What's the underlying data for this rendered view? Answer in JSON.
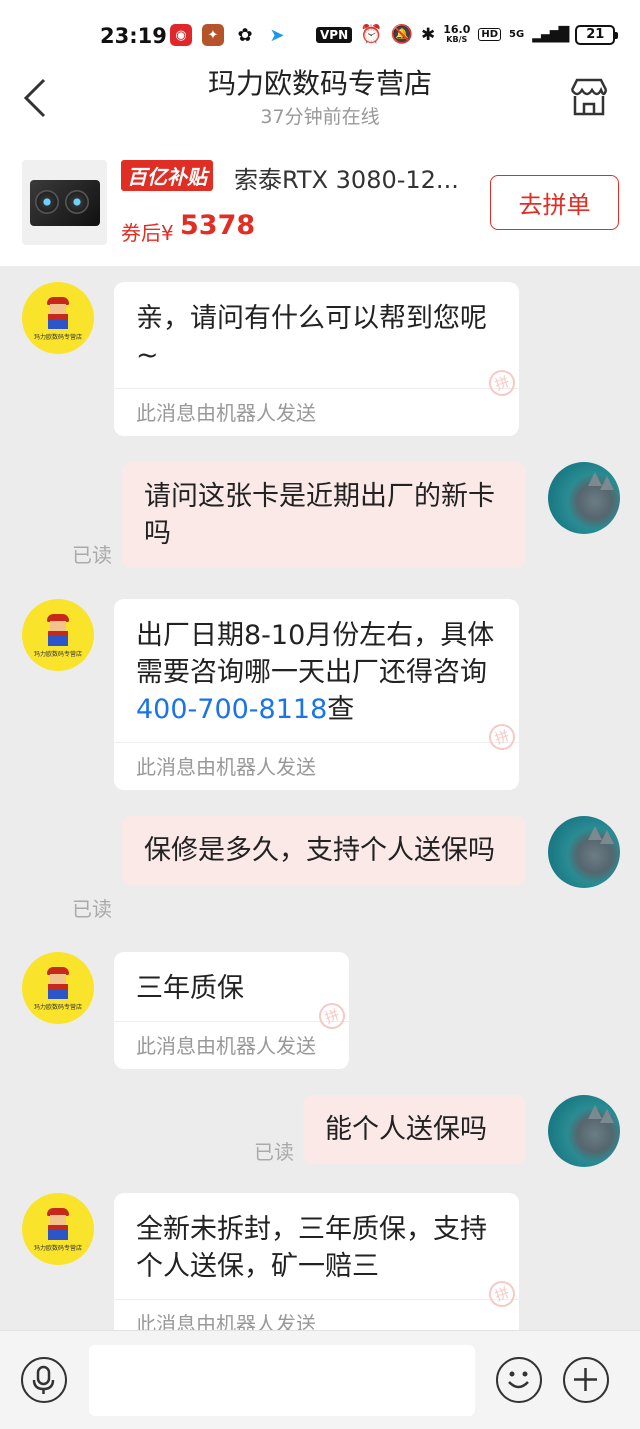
{
  "status_bar": {
    "time": "23:19",
    "vpn": "VPN",
    "speed_value": "16.0",
    "speed_unit": "KB/S",
    "hd": "HD",
    "network": "5G",
    "battery": "21"
  },
  "header": {
    "shop_name": "玛力欧数码专营店",
    "online_status": "37分钟前在线"
  },
  "product": {
    "badge": "百亿补贴",
    "name": "索泰RTX 3080-12...",
    "price_label": "券后¥",
    "price": "5378",
    "join_button": "去拼单"
  },
  "shop_avatar_text": "玛力欧数码专营店",
  "messages": [
    {
      "from": "shop",
      "text": "亲，请问有什么可以帮到您呢~",
      "footer": "此消息由机器人发送"
    },
    {
      "from": "me",
      "text": "请问这张卡是近期出厂的新卡吗",
      "read": "已读"
    },
    {
      "from": "shop",
      "text_before": "出厂日期8-10月份左右，具体需要咨询哪一天出厂还得咨询",
      "phone": "400-700-8118",
      "text_after": "查",
      "footer": "此消息由机器人发送"
    },
    {
      "from": "me",
      "text": "保修是多久，支持个人送保吗",
      "read": "已读"
    },
    {
      "from": "shop",
      "text": "三年质保",
      "footer": "此消息由机器人发送"
    },
    {
      "from": "me",
      "text": "能个人送保吗",
      "read": "已读"
    },
    {
      "from": "shop",
      "text": "全新未拆封，三年质保，支持个人送保，矿一赔三",
      "footer": "此消息由机器人发送"
    }
  ],
  "input_bar": {
    "placeholder": ""
  },
  "colors": {
    "accent_red": "#e02e24",
    "bubble_me": "#fbe9e8",
    "link_blue": "#1a73e8",
    "chat_bg": "#ececec"
  }
}
